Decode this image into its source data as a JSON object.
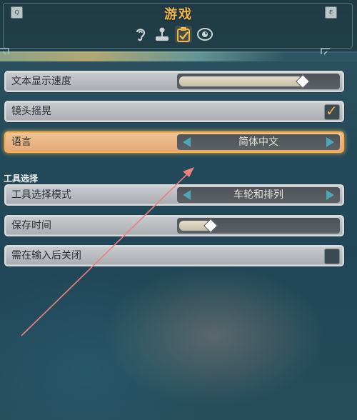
{
  "header": {
    "title": "游戏",
    "left_key": "Q",
    "right_key": "E",
    "tabs": [
      {
        "icon": "ear-icon",
        "active": false
      },
      {
        "icon": "joystick-icon",
        "active": false
      },
      {
        "icon": "clipboard-check-icon",
        "active": true
      },
      {
        "icon": "eye-icon",
        "active": false
      }
    ]
  },
  "settings": [
    {
      "label": "文本显示速度",
      "type": "slider",
      "value": 0.78
    },
    {
      "label": "镜头摇晃",
      "type": "checkbox",
      "checked": true
    },
    {
      "label": "语言",
      "type": "selector",
      "value": "简体中文",
      "selected": true
    }
  ],
  "section": {
    "title": "工具选择"
  },
  "tool_settings": [
    {
      "label": "工具选择模式",
      "type": "selector",
      "value": "车轮和排列"
    },
    {
      "label": "保存时间",
      "type": "slider",
      "value": 0.2
    },
    {
      "label": "需在输入后关闭",
      "type": "checkbox",
      "checked": false
    }
  ],
  "colors": {
    "accent": "#f5b54a",
    "arrow": "#4aa6b8",
    "annotation": "#f07f7f"
  }
}
